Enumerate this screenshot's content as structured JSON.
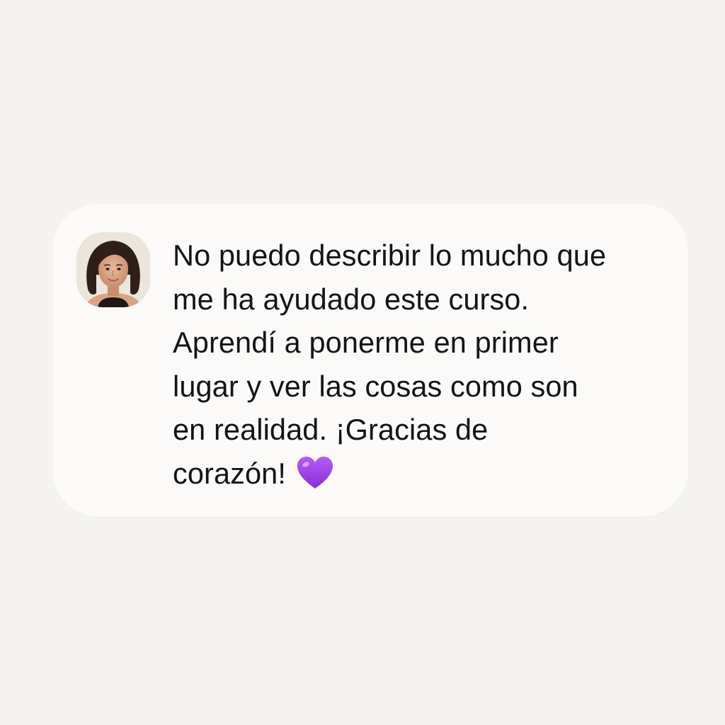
{
  "testimonial": {
    "avatar_icon": "user-photo",
    "message_lines": [
      "No puedo describir lo mucho que",
      "me ha ayudado este curso.",
      "Aprendí a ponerme en primer",
      "lugar y ver las cosas como son",
      "en realidad. ¡Gracias de",
      "corazón!"
    ],
    "emoji_icon": "purple-heart-icon"
  },
  "colors": {
    "background": "#f4f3f1",
    "card": "#fbfaf8",
    "text": "#141414",
    "heart": "#9a3fe6"
  }
}
